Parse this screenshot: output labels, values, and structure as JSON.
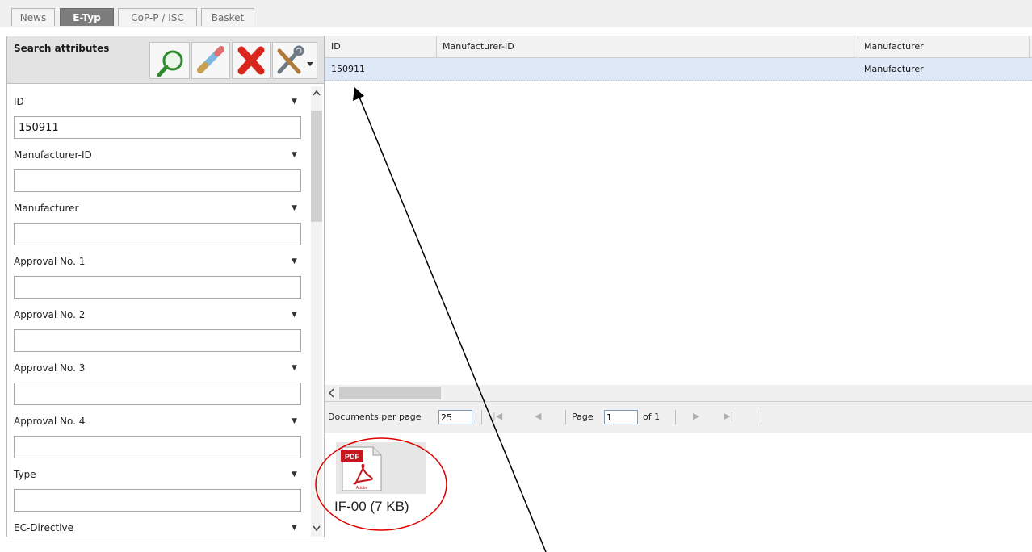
{
  "tabs": [
    {
      "label": "News",
      "active": false
    },
    {
      "label": "E-Typ",
      "active": true
    },
    {
      "label": "CoP-P / ISC",
      "active": false
    },
    {
      "label": "Basket",
      "active": false
    }
  ],
  "search_panel": {
    "title": "Search attributes",
    "toolbar": [
      {
        "name": "search-icon"
      },
      {
        "name": "edit-pencil-icon"
      },
      {
        "name": "delete-x-icon"
      },
      {
        "name": "tools-menu-icon"
      }
    ],
    "fields": [
      {
        "label": "ID",
        "value": ""
      },
      {
        "label": "Manufacturer-ID",
        "value": ""
      },
      {
        "label": "Manufacturer",
        "value": ""
      },
      {
        "label": "Approval No. 1",
        "value": ""
      },
      {
        "label": "Approval No. 2",
        "value": ""
      },
      {
        "label": "Approval No. 3",
        "value": ""
      },
      {
        "label": "Approval No. 4",
        "value": ""
      },
      {
        "label": "Type",
        "value": ""
      },
      {
        "label": "EC-Directive",
        "value": ""
      }
    ],
    "id_value": "150911"
  },
  "grid": {
    "columns": [
      "ID",
      "Manufacturer-ID",
      "Manufacturer"
    ],
    "rows": [
      {
        "id": "150911",
        "manufacturer_id": "",
        "manufacturer": "Manufacturer"
      }
    ]
  },
  "pager": {
    "docs_label": "Documents per page",
    "docs_value": "25",
    "page_label": "Page",
    "page_value": "1",
    "of_label": "of 1"
  },
  "document": {
    "icon": "pdf-icon",
    "pdf_badge": "PDF",
    "adobe_text": "Adobe",
    "label": "IF-00 (7 KB)"
  },
  "colors": {
    "active_tab": "#7c7c7c",
    "selected_row": "#dfe8f6",
    "annotation_circle": "#dd0000",
    "delete_icon": "#d9261c",
    "search_icon": "#2e8b2e"
  }
}
